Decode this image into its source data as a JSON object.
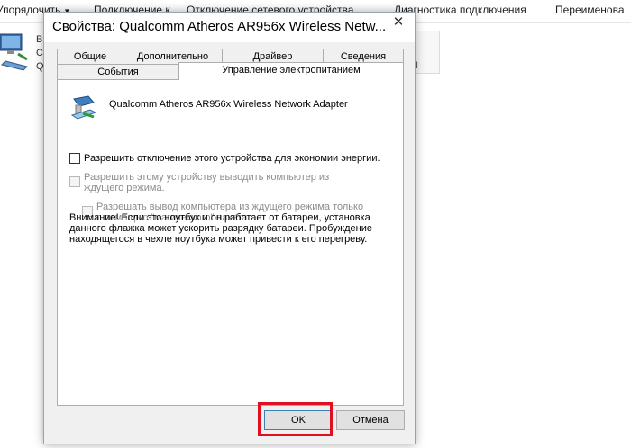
{
  "background_window": {
    "toolbar": [
      {
        "label": "Упорядочить",
        "has_arrow": true
      },
      {
        "label": "Подключение к",
        "has_arrow": false
      },
      {
        "label": "Отключение сетевого устройства",
        "has_arrow": false
      },
      {
        "label": "Диагностика подключения",
        "has_arrow": false
      },
      {
        "label": "Переименова",
        "has_arrow": false
      }
    ],
    "adapter_text": [
      "B",
      "C",
      "Q"
    ],
    "tile_text": "el"
  },
  "dialog": {
    "title": "Свойства: Qualcomm Atheros AR956x Wireless Netw...",
    "close_glyph": "✕",
    "tabs_row1": [
      "Общие",
      "Дополнительно",
      "Драйвер",
      "Сведения"
    ],
    "tabs_row2": [
      "События",
      "Управление электропитанием"
    ],
    "active_tab": "Управление электропитанием",
    "device_name": "Qualcomm Atheros AR956x Wireless Network Adapter",
    "options": [
      {
        "label": "Разрешить отключение этого устройства для экономии энергии.",
        "checked": false,
        "enabled": true
      },
      {
        "label": "Разрешить этому устройству выводить компьютер из ждущего режима.",
        "checked": false,
        "enabled": false
      },
      {
        "label": "Разрешать вывод компьютера из ждущего режима только с помощью \"магического\" пакета.",
        "checked": false,
        "enabled": false
      }
    ],
    "warning": "Внимание! Если это ноутбук и он работает от батареи, установка данного флажка может ускорить разрядку батареи. Пробуждение находящегося в чехле ноутбука может привести к его перегреву.",
    "buttons": {
      "ok": "OK",
      "cancel": "Отмена"
    },
    "highlight_color": "#e01020"
  }
}
